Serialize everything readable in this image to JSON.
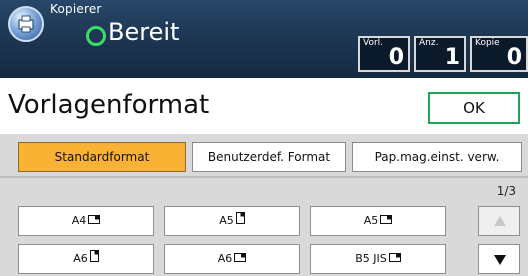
{
  "header": {
    "app_title": "Kopierer",
    "status": "Bereit",
    "counters": [
      {
        "label": "Vorl.",
        "value": "0"
      },
      {
        "label": "Anz.",
        "value": "1"
      },
      {
        "label": "Kopie",
        "value": "0"
      }
    ],
    "status_color": "#3ddc66"
  },
  "page": {
    "title": "Vorlagenformat",
    "ok_label": "OK"
  },
  "tabs": [
    {
      "label": "Standardformat",
      "selected": true
    },
    {
      "label": "Benutzerdef. Format",
      "selected": false
    },
    {
      "label": "Pap.mag.einst. verw.",
      "selected": false
    }
  ],
  "page_indicator": "1/3",
  "formats": [
    {
      "label": "A4",
      "icon": "landscape-paper-icon"
    },
    {
      "label": "A5",
      "icon": "portrait-paper-icon"
    },
    {
      "label": "A5",
      "icon": "landscape-paper-icon"
    },
    {
      "label": "A6",
      "icon": "portrait-paper-icon"
    },
    {
      "label": "A6",
      "icon": "landscape-paper-icon"
    },
    {
      "label": "B5 JIS",
      "icon": "landscape-paper-icon"
    }
  ],
  "colors": {
    "selected_tab": "#f9b233",
    "ok_border": "#1fa35a",
    "header_bg": "#1c3550"
  }
}
